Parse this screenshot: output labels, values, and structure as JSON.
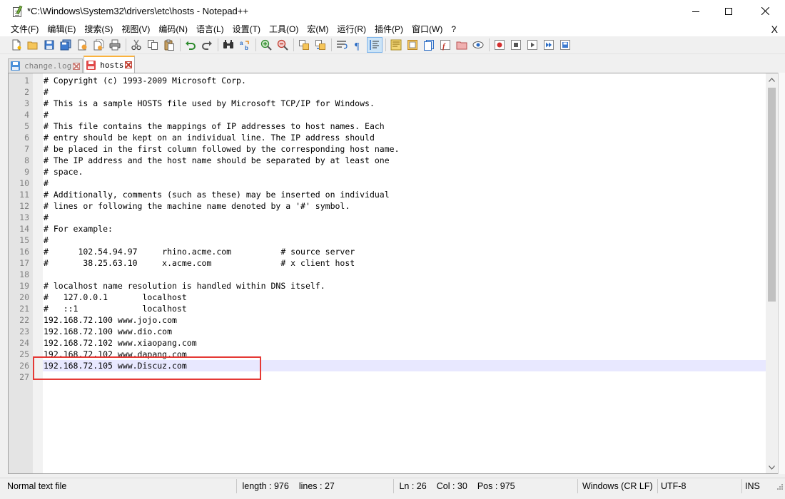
{
  "window": {
    "title": "*C:\\Windows\\System32\\drivers\\etc\\hosts - Notepad++",
    "menu_close": "X"
  },
  "menu": [
    {
      "label": "文件(F)"
    },
    {
      "label": "编辑(E)"
    },
    {
      "label": "搜索(S)"
    },
    {
      "label": "视图(V)"
    },
    {
      "label": "编码(N)"
    },
    {
      "label": "语言(L)"
    },
    {
      "label": "设置(T)"
    },
    {
      "label": "工具(O)"
    },
    {
      "label": "宏(M)"
    },
    {
      "label": "运行(R)"
    },
    {
      "label": "插件(P)"
    },
    {
      "label": "窗口(W)"
    },
    {
      "label": "?"
    }
  ],
  "tabs": [
    {
      "label": "change.log",
      "active": false,
      "icon_color": "#4a90d9"
    },
    {
      "label": "hosts",
      "active": true,
      "icon_color": "#e04848"
    }
  ],
  "editor": {
    "current_line": 26,
    "lines": [
      "# Copyright (c) 1993-2009 Microsoft Corp.",
      "#",
      "# This is a sample HOSTS file used by Microsoft TCP/IP for Windows.",
      "#",
      "# This file contains the mappings of IP addresses to host names. Each",
      "# entry should be kept on an individual line. The IP address should",
      "# be placed in the first column followed by the corresponding host name.",
      "# The IP address and the host name should be separated by at least one",
      "# space.",
      "#",
      "# Additionally, comments (such as these) may be inserted on individual",
      "# lines or following the machine name denoted by a '#' symbol.",
      "#",
      "# For example:",
      "#",
      "#      102.54.94.97     rhino.acme.com          # source server",
      "#       38.25.63.10     x.acme.com              # x client host",
      "",
      "# localhost name resolution is handled within DNS itself.",
      "#   127.0.0.1       localhost",
      "#   ::1             localhost",
      "192.168.72.100 www.jojo.com",
      "192.168.72.100 www.dio.com",
      "192.168.72.102 www.xiaopang.com",
      "192.168.72.102 www.dapang.com",
      "192.168.72.105 www.Discuz.com",
      ""
    ]
  },
  "status": {
    "file_type": "Normal text file",
    "length": "length : 976",
    "lines": "lines : 27",
    "ln": "Ln : 26",
    "col": "Col : 30",
    "pos": "Pos : 975",
    "eol": "Windows (CR LF)",
    "encoding": "UTF-8",
    "mode": "INS"
  },
  "colors": {
    "highlight_box": "#e53935",
    "current_line_bg": "#e8e8ff",
    "active_tab_accent": "#fab23d"
  },
  "toolbar": [
    "new-file-icon",
    "open-file-icon",
    "save-icon",
    "save-all-icon",
    "close-icon",
    "close-all-icon",
    "print-icon",
    "|",
    "cut-icon",
    "copy-icon",
    "paste-icon",
    "|",
    "undo-icon",
    "redo-icon",
    "|",
    "find-icon",
    "replace-icon",
    "|",
    "zoom-in-icon",
    "zoom-out-icon",
    "|",
    "sync-vertical-icon",
    "sync-horizontal-icon",
    "|",
    "word-wrap-icon",
    "show-all-chars-icon",
    "indent-guide-icon",
    "|",
    "user-language-icon",
    "doc-map-icon",
    "doc-list-icon",
    "function-list-icon",
    "folder-workspace-icon",
    "monitoring-icon",
    "|",
    "record-macro-icon",
    "stop-record-icon",
    "play-macro-icon",
    "run-macro-multiple-icon",
    "save-macro-icon"
  ]
}
